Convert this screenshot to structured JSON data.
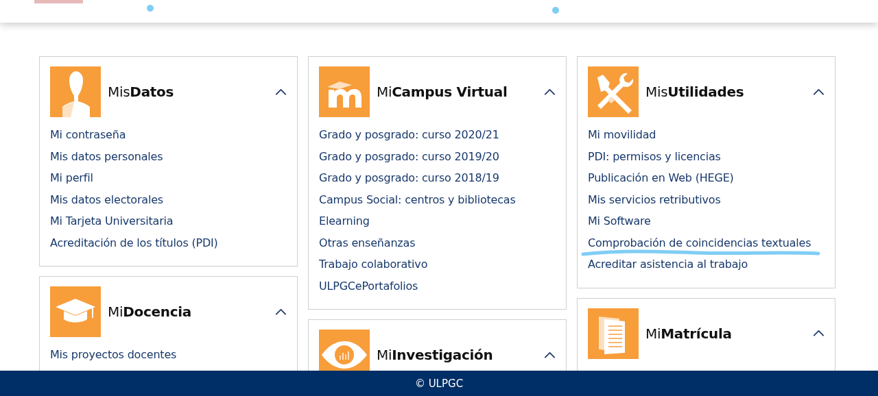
{
  "columns": [
    {
      "cards": [
        {
          "kind": "person",
          "title": "Mis**Datos**",
          "expanded": true,
          "links": [
            {
              "label": "Mi contraseña",
              "marked": false
            },
            {
              "label": "Mis datos personales",
              "marked": false
            },
            {
              "label": "Mi perfil",
              "marked": false
            },
            {
              "label": "Mis datos electorales",
              "marked": false
            },
            {
              "label": "Mi Tarjeta Universitaria",
              "marked": false
            },
            {
              "label": "Acreditación de los títulos (PDI)",
              "marked": false
            }
          ]
        },
        {
          "kind": "mortarboard",
          "title": "Mi**Docencia**",
          "expanded": true,
          "links": [
            {
              "label": "Mis proyectos docentes",
              "marked": false
            }
          ]
        }
      ]
    },
    {
      "cards": [
        {
          "kind": "moodle",
          "title": "Mi**Campus Virtual**",
          "expanded": true,
          "links": [
            {
              "label": "Grado y posgrado: curso 2020/21",
              "marked": false
            },
            {
              "label": "Grado y posgrado: curso 2019/20",
              "marked": false
            },
            {
              "label": "Grado y posgrado: curso 2018/19",
              "marked": false
            },
            {
              "label": "Campus Social: centros y bibliotecas",
              "marked": false
            },
            {
              "label": "Elearning",
              "marked": false
            },
            {
              "label": "Otras enseñanzas",
              "marked": false
            },
            {
              "label": "Trabajo colaborativo",
              "marked": false
            },
            {
              "label": "ULPGCePortafolios",
              "marked": false
            }
          ]
        },
        {
          "kind": "eye",
          "title": "Mi**Investigación**",
          "expanded": true
        }
      ]
    },
    {
      "cards": [
        {
          "kind": "tools",
          "title": "Mis**Utilidades**",
          "expanded": true,
          "links": [
            {
              "label": "Mi movilidad",
              "marked": false
            },
            {
              "label": "PDI: permisos y licencias",
              "marked": false
            },
            {
              "label": "Publicación en Web (HEGE)",
              "marked": false
            },
            {
              "label": "Mis servicios retributivos",
              "marked": false
            },
            {
              "label": "Mi Software",
              "marked": false
            },
            {
              "label": "Comprobación de coincidencias textuales",
              "marked": true
            },
            {
              "label": "Acreditar asistencia al trabajo",
              "marked": false
            }
          ]
        },
        {
          "kind": "documents",
          "title": "Mi**Matrícula**",
          "expanded": true
        }
      ]
    }
  ],
  "footer": {
    "text": "© ULPGC"
  }
}
